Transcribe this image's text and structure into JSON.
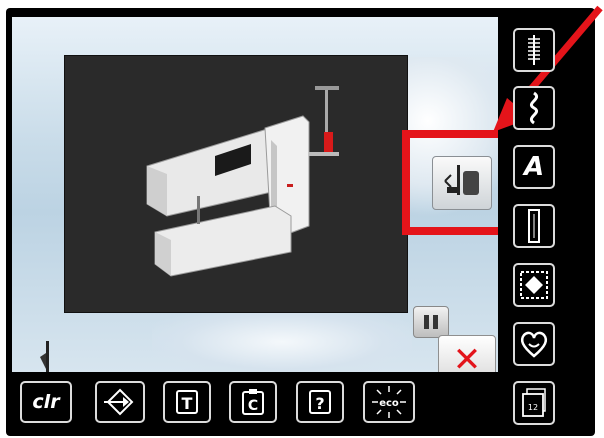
{
  "left_panel": {
    "sewing_button_icon": "foot-pressure-icon",
    "close_button_icon": "close-icon",
    "pause_button_icon": "pause-icon",
    "needle_indicator_icon": "presser-foot-icon"
  },
  "side_menu": {
    "items": [
      {
        "icon": "practical-stitch-icon"
      },
      {
        "icon": "decorative-stitch-icon"
      },
      {
        "icon": "alphabet-icon",
        "label": "A"
      },
      {
        "icon": "buttonhole-icon"
      },
      {
        "icon": "quilt-stitch-icon"
      },
      {
        "icon": "heart-icon"
      },
      {
        "icon": "personal-program-icon",
        "label": "12"
      }
    ]
  },
  "bottom_toolbar": {
    "items": [
      {
        "icon": "clr-icon",
        "label": "clr"
      },
      {
        "icon": "arrow-diamond-icon"
      },
      {
        "icon": "setup-icon",
        "label": "T"
      },
      {
        "icon": "clipboard-c-icon",
        "label": "C"
      },
      {
        "icon": "help-icon",
        "label": "?"
      },
      {
        "icon": "eco-icon",
        "label": "eco"
      }
    ]
  },
  "colors": {
    "highlight": "#e4141a",
    "close_x": "#e3141b",
    "button_border": "#dcdcdc"
  }
}
